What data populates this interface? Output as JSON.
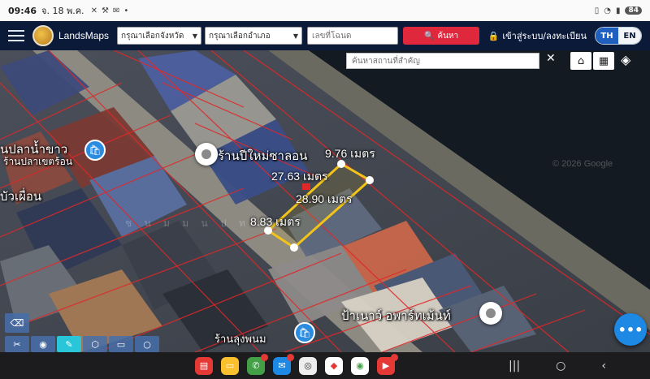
{
  "status_bar": {
    "time": "09:46",
    "date": "จ. 18 พ.ค.",
    "battery": "84"
  },
  "nav": {
    "brand": "LandsMaps",
    "province_select": "กรุณาเลือกจังหวัด",
    "district_select": "กรุณาเลือกอำเภอ",
    "deed_placeholder": "เลขที่โฉนด",
    "search_button": "ค้นหา",
    "login": "เข้าสู่ระบบ/ลงทะเบียน",
    "lang_th": "TH",
    "lang_en": "EN"
  },
  "map": {
    "place_search_placeholder": "ค้นหาสถานที่สำคัญ",
    "labels": {
      "shop_left": "นปลาน้ำขาว",
      "shop_left_sub": "ร้านปลาเขตร้อน",
      "bua_fuen": "บัวเผื่อน",
      "main_shop": "ร้านปีใหม่ซาลอน",
      "apartment": "ป้าเนาว์ อพาร์ทเม้นท์",
      "bottom_shop": "ร้านลุงพนม"
    },
    "measurements": {
      "m1": "9.76 เมตร",
      "m2": "27.63 เมตร",
      "m3": "28.90 เมตร",
      "m4": "8.83 เมตร"
    },
    "parcel_overlay_text": "ช  น  ม  ม  น  ป  ท  ต  า",
    "imagery_credit": "© 2026 Google"
  },
  "colors": {
    "accent": "#e0283d",
    "nav_bg": "#0c1a3a",
    "parcel_line": "#e02828",
    "selected_parcel": "#f2c318",
    "fab": "#1e88e5"
  }
}
